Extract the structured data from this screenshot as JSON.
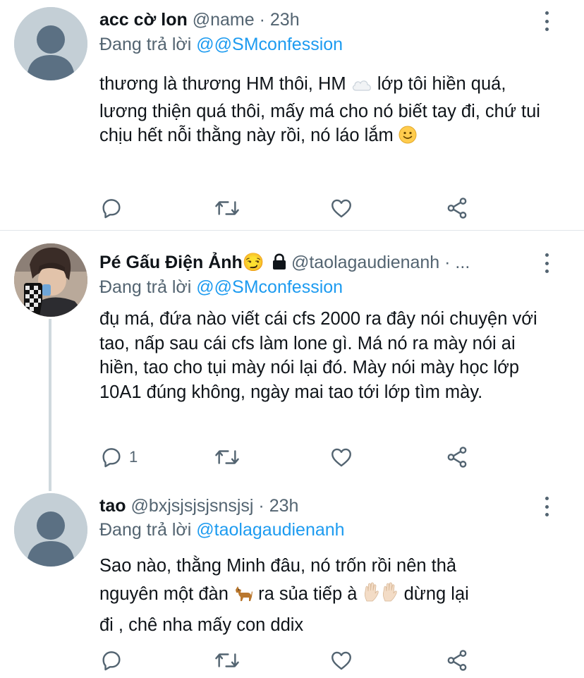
{
  "tweets": [
    {
      "name": "acc cờ lon",
      "handle": "@name",
      "sep": "·",
      "time": "23h",
      "replying_prefix": "Đang trả lời",
      "replying_to": "@@SMconfession",
      "text_part1": "thương là thương HM thôi, HM",
      "text_part2": "lớp tôi hiền quá, lương thiện quá thôi, mấy má cho nó biết tay đi, chứ tui chịu hết nỗi thằng này rồi, nó láo lắm",
      "reply_count": ""
    },
    {
      "name": "Pé Gấu Điện Ảnh😏",
      "handle": "@taolagaudienanh · ...",
      "replying_prefix": "Đang trả lời",
      "replying_to": "@@SMconfession",
      "text": "đụ má, đứa nào viết cái cfs 2000 ra đây nói chuyện với tao, nấp sau cái cfs làm lone gì. Má nó ra mày nói ai hiền, tao cho tụi mày nói lại đó. Mày nói mày học lớp 10A1 đúng không, ngày mai tao tới lớp tìm mày.",
      "reply_count": "1"
    },
    {
      "name": "tao",
      "handle": "@bxjsjsjsjsnsjsj",
      "sep": "·",
      "time": "23h",
      "replying_prefix": "Đang trả lời",
      "replying_to": "@taolagaudienanh",
      "text_line1": "Sao nào, thằng Minh đâu, nó trốn rồi nên thả",
      "text_part_a": "nguyên một đàn",
      "text_part_b": "ra sủa tiếp à",
      "text_part_c": "dừng lại",
      "text_line3": "đi , chê nha mấy con ddix",
      "reply_count": ""
    }
  ],
  "icons": {
    "reply": "reply-icon",
    "retweet": "retweet-icon",
    "like": "heart-icon",
    "share": "share-icon",
    "more": "more-vertical-icon",
    "lock": "lock-icon"
  },
  "colors": {
    "text": "#0f1419",
    "secondary": "#536471",
    "link": "#1d9bf0",
    "divider": "#e1e6ea",
    "thread_line": "#cfd9de",
    "avatar_placeholder": "#c4cfd6"
  }
}
